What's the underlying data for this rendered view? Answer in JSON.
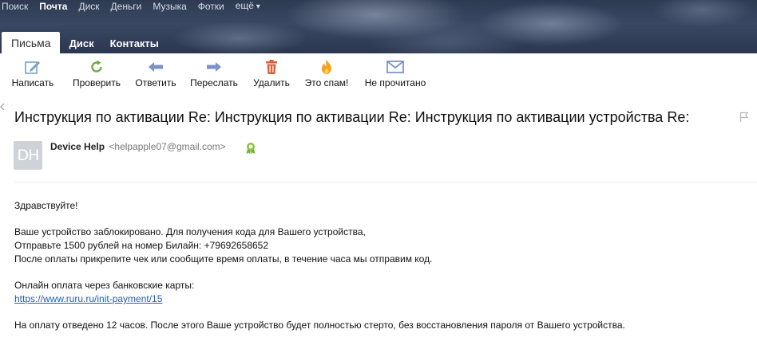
{
  "topnav": {
    "items": [
      "Поиск",
      "Почта",
      "Диск",
      "Деньги",
      "Музыка",
      "Фотки",
      "ещё"
    ],
    "active_index": 1
  },
  "tabs": [
    "Письма",
    "Диск",
    "Контакты"
  ],
  "toolbar": {
    "compose": "Написать",
    "check": "Проверить",
    "reply": "Ответить",
    "forward": "Переслать",
    "delete": "Удалить",
    "spam": "Это спам!",
    "unread": "Не прочитано"
  },
  "icons": {
    "compose": "pencil-icon",
    "check": "refresh-icon",
    "reply": "arrow-left-icon",
    "forward": "arrow-right-icon",
    "delete": "trash-icon",
    "spam": "fire-icon",
    "unread": "envelope-icon"
  },
  "colors": {
    "compose_icon": "#7aa0c4",
    "check_icon": "#6fae3f",
    "arrow_icon": "#7b93c6",
    "delete_icon": "#d9603a",
    "spam_icon": "#f3a21b",
    "unread_icon": "#7b93c6",
    "link": "#1a62b8"
  },
  "message": {
    "subject": "Инструкция по активации Re: Инструкция по активации Re: Инструкция по активации устройства Re:",
    "avatar_initials": "DH",
    "sender_name": "Device Help",
    "sender_email": "<helpapple07@gmail.com>",
    "body": {
      "greeting": "Здравствуйте!",
      "line1": "Ваше устройство заблокировано. Для получения кода для Вашего устройства,",
      "line2": "Отправьте 1500 рублей на номер Билайн: +79692658652",
      "line3": "После оплаты прикрепите чек или сообщите время оплаты, в течение часа мы отправим код.",
      "line4": "Онлайн оплата через банковские карты:",
      "link": "https://www.ruru.ru/init-payment/15",
      "line5": "На оплату отведено 12 часов. После этого Ваше устройство будет полностью стерто, без восстановления пароля от Вашего устройства."
    }
  }
}
